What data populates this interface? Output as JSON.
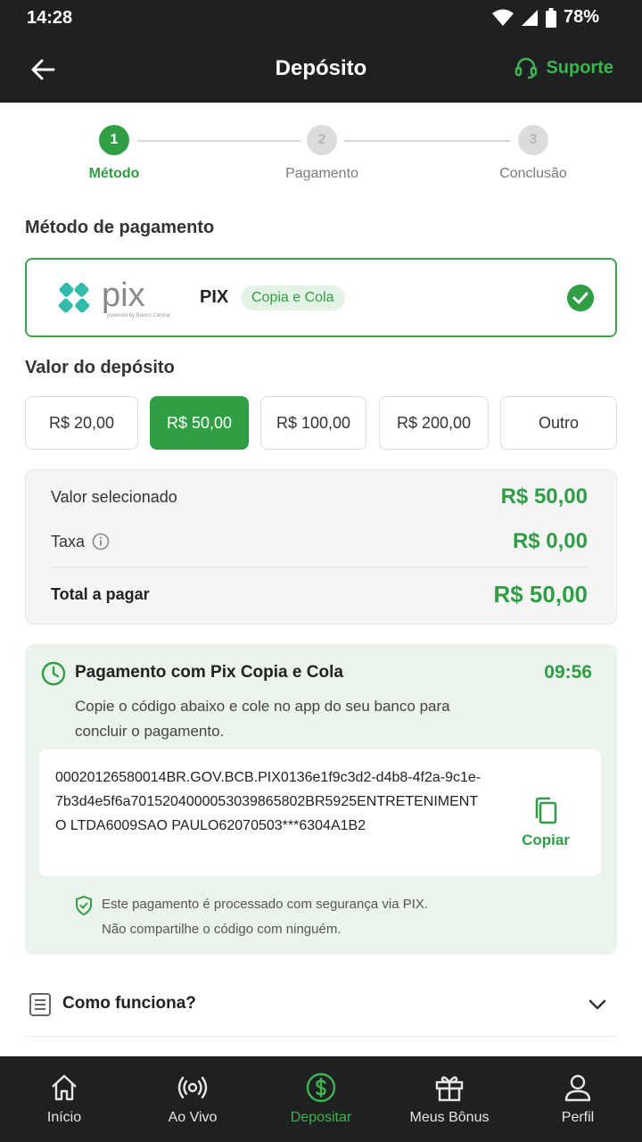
{
  "status": {
    "time": "14:28",
    "battery": "78%"
  },
  "header": {
    "title": "Depósito",
    "support_label": "Suporte"
  },
  "stepper": [
    {
      "num": "1",
      "label": "Método",
      "state": "active"
    },
    {
      "num": "2",
      "label": "Pagamento",
      "state": "inactive"
    },
    {
      "num": "3",
      "label": "Conclusão",
      "state": "inactive"
    }
  ],
  "payment_method": {
    "section_title": "Método de pagamento",
    "logo_text": "pix",
    "logo_caption": "powered by Banco Central",
    "name": "PIX",
    "badge": "Copia e Cola"
  },
  "deposit": {
    "section_title": "Valor do depósito",
    "options": [
      {
        "label": "R$ 20,00",
        "selected": false
      },
      {
        "label": "R$ 50,00",
        "selected": true
      },
      {
        "label": "R$ 100,00",
        "selected": false
      },
      {
        "label": "R$ 200,00",
        "selected": false
      },
      {
        "label": "Outro",
        "selected": false
      }
    ]
  },
  "summary": {
    "selected_label": "Valor selecionado",
    "selected_value": "R$ 50,00",
    "fee_label": "Taxa",
    "fee_value": "R$ 0,00",
    "total_label": "Total a pagar",
    "total_value": "R$ 50,00"
  },
  "pix_payment": {
    "title": "Pagamento com Pix Copia e Cola",
    "timer": "09:56",
    "description": "Copie o código abaixo e cole no app do seu banco para concluir o pagamento.",
    "code": "00020126580014BR.GOV.BCB.PIX0136e1f9c3d2-d4b8-4f2a-9c1e-7b3d4e5f6a7015204000053039865802BR5925ENTRETENIMENTO LTDA6009SAO PAULO62070503***6304A1B2",
    "copy_label": "Copiar",
    "security_line1": "Este pagamento é processado com segurança via PIX.",
    "security_line2": "Não compartilhe o código com ninguém."
  },
  "howto": {
    "label": "Como funciona?"
  },
  "nav": [
    {
      "label": "Início",
      "icon": "home-icon",
      "active": false
    },
    {
      "label": "Ao Vivo",
      "icon": "live-icon",
      "active": false
    },
    {
      "label": "Depositar",
      "icon": "dollar-icon",
      "active": true
    },
    {
      "label": "Meus Bônus",
      "icon": "gift-icon",
      "active": false
    },
    {
      "label": "Perfil",
      "icon": "user-icon",
      "active": false
    }
  ],
  "colors": {
    "accent": "#2f9e44",
    "dark_bar": "#1f2022",
    "pix_teal": "#32bcad"
  }
}
